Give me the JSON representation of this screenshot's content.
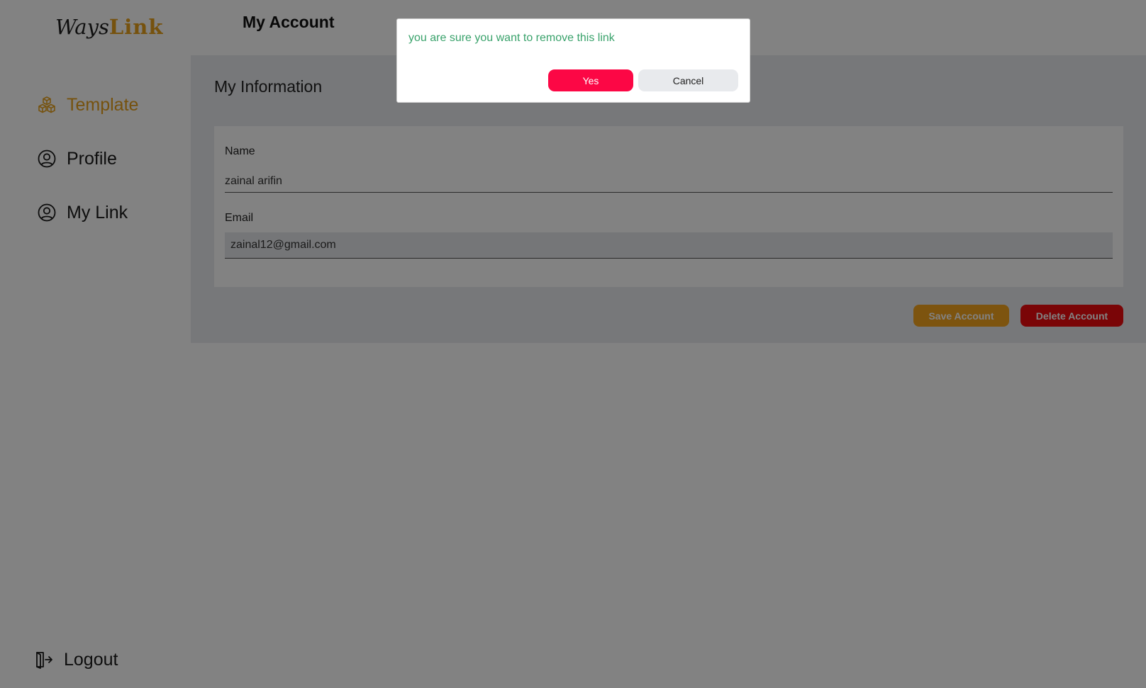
{
  "app": {
    "logo_part1": "Ways",
    "logo_part2": "Link",
    "accent_color": "#e8a11c"
  },
  "header": {
    "title": "My Account"
  },
  "sidebar": {
    "items": [
      {
        "label": "Template",
        "icon": "cubes-icon",
        "active": true
      },
      {
        "label": "Profile",
        "icon": "user-circle-icon",
        "active": false
      },
      {
        "label": "My Link",
        "icon": "user-circle-icon",
        "active": false
      }
    ],
    "logout": {
      "label": "Logout",
      "icon": "logout-icon"
    }
  },
  "main": {
    "section_title": "My Information",
    "name": {
      "label": "Name",
      "value": "zainal arifin"
    },
    "email": {
      "label": "Email",
      "value": "zainal12@gmail.com"
    },
    "save_label": "Save Account",
    "delete_label": "Delete Account"
  },
  "modal": {
    "message": "you are sure you want to remove this link",
    "yes_label": "Yes",
    "cancel_label": "Cancel",
    "yes_color": "#fc0745"
  }
}
